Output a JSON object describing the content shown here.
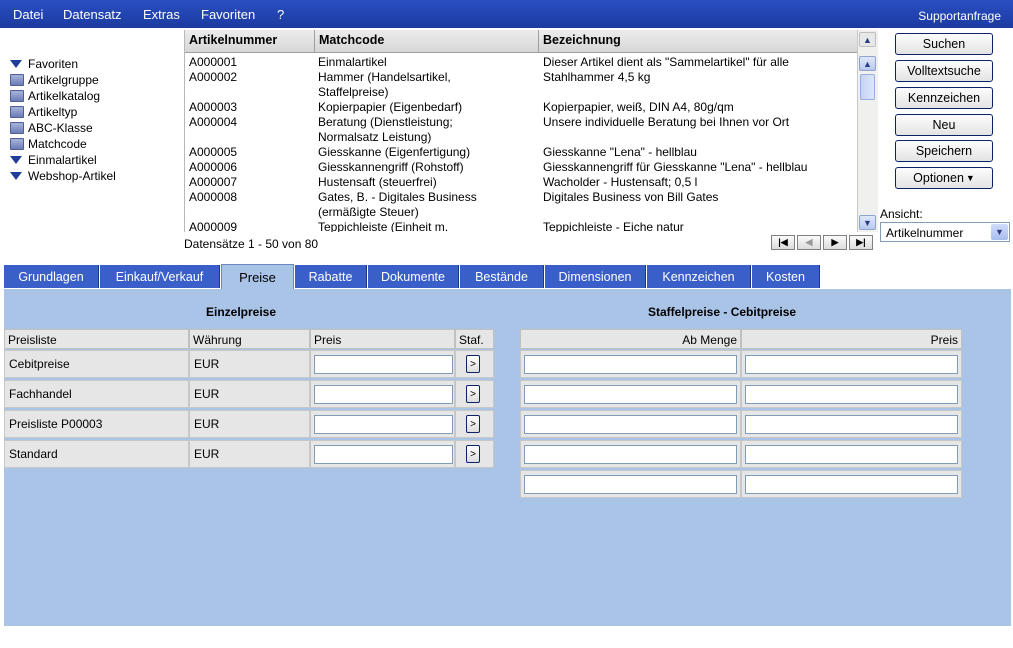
{
  "menu": {
    "items": [
      "Datei",
      "Datensatz",
      "Extras",
      "Favoriten",
      "?"
    ],
    "support": "Supportanfrage"
  },
  "tree": {
    "items": [
      {
        "label": "Favoriten",
        "icon": "filter-icon"
      },
      {
        "label": "Artikelgruppe",
        "icon": "folder-icon"
      },
      {
        "label": "Artikelkatalog",
        "icon": "folder-icon"
      },
      {
        "label": "Artikeltyp",
        "icon": "folder-icon"
      },
      {
        "label": "ABC-Klasse",
        "icon": "folder-icon"
      },
      {
        "label": "Matchcode",
        "icon": "folder-icon"
      },
      {
        "label": "Einmalartikel",
        "icon": "filter-icon"
      },
      {
        "label": "Webshop-Artikel",
        "icon": "filter-icon"
      }
    ]
  },
  "grid": {
    "columns": [
      "Artikelnummer",
      "Matchcode",
      "Bezeichnung"
    ],
    "rows": [
      {
        "nr": "A000001",
        "match": "Einmalartikel",
        "bez": "Dieser Artikel dient als \"Sammelartikel\" für alle"
      },
      {
        "nr": "A000002",
        "match": "Hammer (Handelsartikel,\nStaffelpreise)",
        "bez": "Stahlhammer 4,5 kg"
      },
      {
        "nr": "A000003",
        "match": "Kopierpapier (Eigenbedarf)",
        "bez": "Kopierpapier, weiß, DIN A4, 80g/qm"
      },
      {
        "nr": "A000004",
        "match": "Beratung (Dienstleistung;\nNormalsatz Leistung)",
        "bez": "Unsere individuelle Beratung bei Ihnen vor Ort"
      },
      {
        "nr": "A000005",
        "match": "Giesskanne (Eigenfertigung)",
        "bez": "Giesskanne \"Lena\" - hellblau"
      },
      {
        "nr": "A000006",
        "match": "Giesskannengriff (Rohstoff)",
        "bez": "Giesskannengriff für Giesskanne \"Lena\" - hellblau"
      },
      {
        "nr": "A000007",
        "match": "Hustensaft (steuerfrei)",
        "bez": "Wacholder - Hustensaft; 0,5 l"
      },
      {
        "nr": "A000008",
        "match": "Gates, B. - Digitales Business\n(ermäßigte Steuer)",
        "bez": "Digitales Business von Bill Gates"
      },
      {
        "nr": "A000009",
        "match": "Teppichleiste (Einheit m.",
        "bez": "Teppichleiste - Eiche natur"
      }
    ],
    "record_count": "Datensätze 1 - 50 von 80"
  },
  "buttons": {
    "search": "Suchen",
    "fulltext": "Volltextsuche",
    "flags": "Kennzeichen",
    "new": "Neu",
    "save": "Speichern",
    "options": "Optionen"
  },
  "view": {
    "label": "Ansicht:",
    "value": "Artikelnummer"
  },
  "tabs": [
    "Grundlagen",
    "Einkauf/Verkauf",
    "Preise",
    "Rabatte",
    "Dokumente",
    "Bestände",
    "Dimensionen",
    "Kennzeichen",
    "Kosten"
  ],
  "active_tab": "Preise",
  "einzelpreise": {
    "title": "Einzelpreise",
    "headers": [
      "Preisliste",
      "Währung",
      "Preis",
      "Staf."
    ],
    "rows": [
      {
        "list": "Cebitpreise",
        "currency": "EUR",
        "price": ""
      },
      {
        "list": "Fachhandel",
        "currency": "EUR",
        "price": ""
      },
      {
        "list": "Preisliste P00003",
        "currency": "EUR",
        "price": ""
      },
      {
        "list": "Standard",
        "currency": "EUR",
        "price": ""
      }
    ],
    "staffel_button": ">"
  },
  "staffelpreise": {
    "title": "Staffelpreise - Cebitpreise",
    "headers": [
      "Ab Menge",
      "Preis"
    ],
    "rows": 5
  }
}
